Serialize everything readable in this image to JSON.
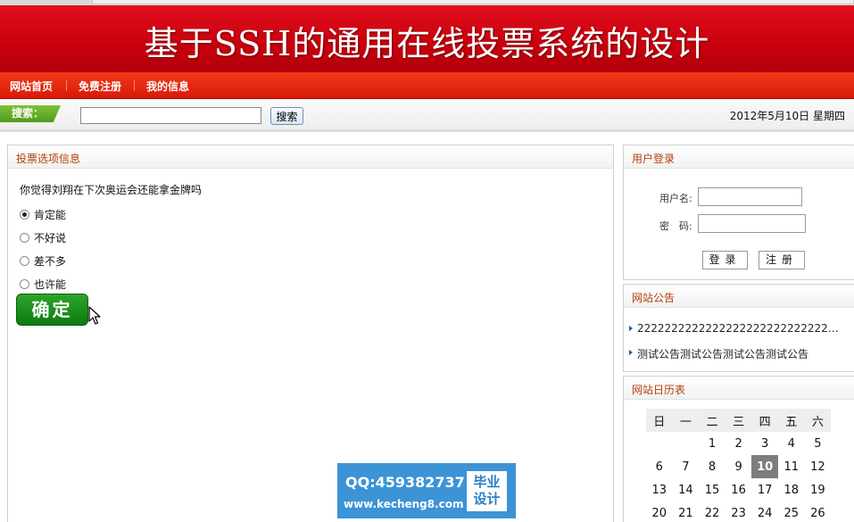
{
  "banner": {
    "title": "基于SSH的通用在线投票系统的设计"
  },
  "nav": {
    "items": [
      "网站首页",
      "免费注册",
      "我的信息"
    ]
  },
  "search": {
    "label": "搜索：",
    "value": "",
    "button": "搜索",
    "date": "2012年5月10日 星期四"
  },
  "vote": {
    "header": "投票选项信息",
    "question": "你觉得刘翔在下次奥运会还能拿金牌吗",
    "options": [
      "肯定能",
      "不好说",
      "差不多",
      "也许能"
    ],
    "selected": 0,
    "submit": "确定"
  },
  "login": {
    "header": "用户登录",
    "username_label": "用户名:",
    "password_label": "密　码:",
    "login_button": "登录",
    "register_button": "注册"
  },
  "notice": {
    "header": "网站公告",
    "items": [
      "2222222222222222222222222222222",
      "测试公告测试公告测试公告测试公告"
    ]
  },
  "calendar": {
    "header": "网站日历表",
    "weekdays": [
      "日",
      "一",
      "二",
      "三",
      "四",
      "五",
      "六"
    ],
    "weeks": [
      [
        "",
        "",
        "1",
        "2",
        "3",
        "4",
        "5"
      ],
      [
        "6",
        "7",
        "8",
        "9",
        "10",
        "11",
        "12"
      ],
      [
        "13",
        "14",
        "15",
        "16",
        "17",
        "18",
        "19"
      ],
      [
        "20",
        "21",
        "22",
        "23",
        "24",
        "25",
        "26"
      ]
    ],
    "today": "10"
  },
  "watermark": {
    "qq": "QQ:459382737",
    "site": "www.kecheng8.com",
    "badge_line1": "毕业",
    "badge_line2": "设计"
  }
}
